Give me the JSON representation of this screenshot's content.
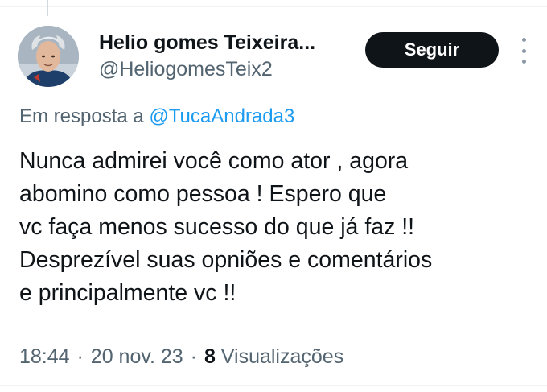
{
  "tweet": {
    "author": {
      "display_name": "Helio gomes Teixeira...",
      "handle": "@HeliogomesTeix2",
      "avatar_icon": "profile-photo"
    },
    "follow_label": "Seguir",
    "more_icon": "more-dots-vertical-icon",
    "reply_prefix": "Em resposta a",
    "reply_to": "@TucaAndrada3",
    "text_lines": [
      "Nunca admirei você como ator , agora",
      "abomino como pessoa ! Espero que",
      "vc faça menos sucesso do que já faz !!",
      "Desprezível suas opniões e comentários",
      "e principalmente vc !!"
    ],
    "time": "18:44",
    "date": "20 nov. 23",
    "views_count": "8",
    "views_label": "Visualizações",
    "separator": "·"
  },
  "colors": {
    "text_primary": "#0f1419",
    "text_secondary": "#536471",
    "link": "#1d9bf0",
    "button_bg": "#0f1419",
    "button_text": "#ffffff",
    "divider": "#eff3f4"
  }
}
